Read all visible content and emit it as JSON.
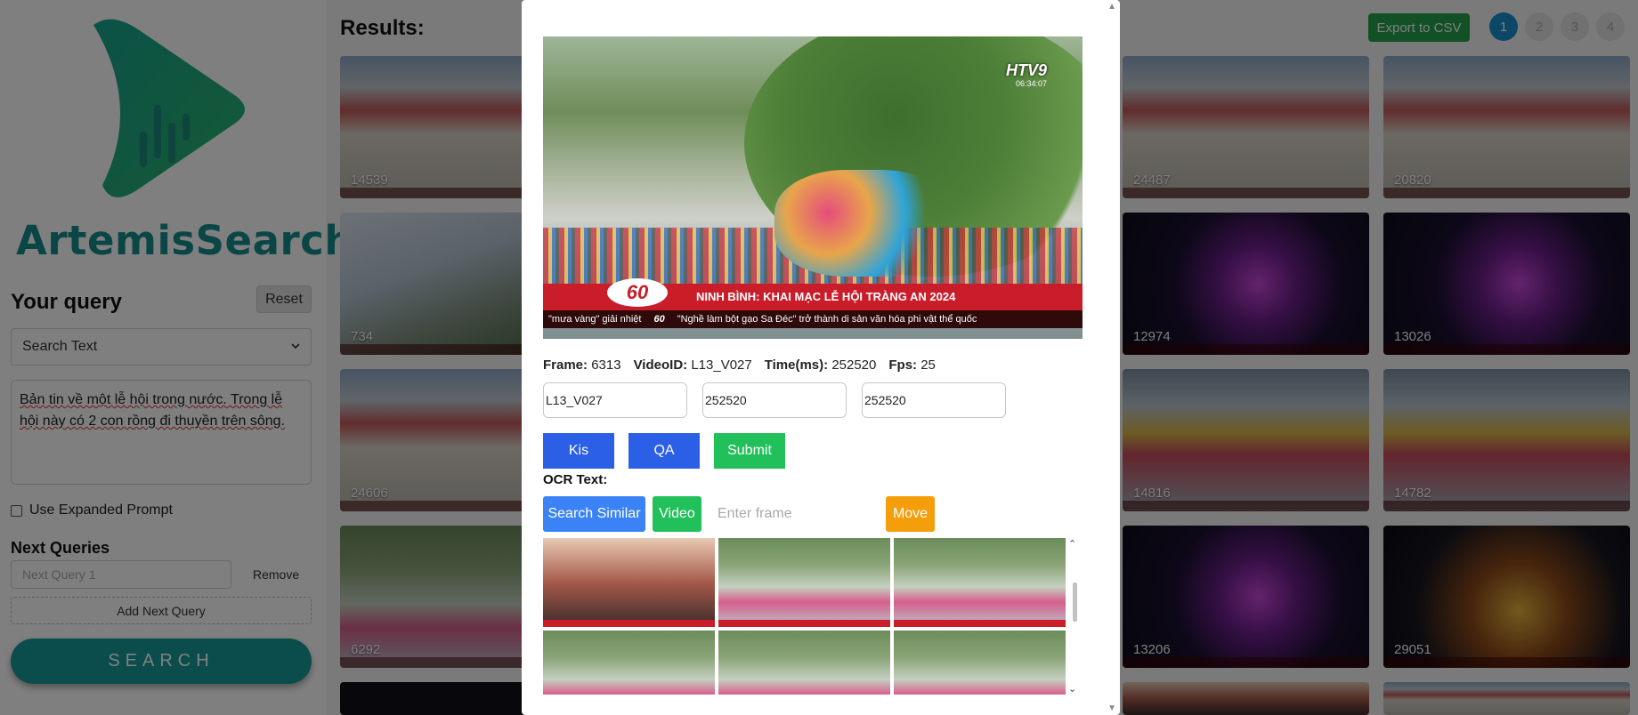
{
  "sidebar": {
    "brand": "ArtemisSearch",
    "query_title": "Your query",
    "reset_label": "Reset",
    "search_mode": "Search Text",
    "query_text_1": "Bản tin về một lễ hội trong nước. Trong lễ",
    "query_text_2": "hội này có 2 con rồng đi thuyền trên sông.",
    "expanded_prompt_label": "Use Expanded Prompt",
    "next_queries_title": "Next Queries",
    "next_query_placeholder": "Next Query 1",
    "remove_label": "Remove",
    "add_next_label": "Add Next Query",
    "search_label": "SEARCH"
  },
  "results": {
    "title": "Results:",
    "export_label": "Export to CSV",
    "pages": [
      "1",
      "2",
      "3",
      "4"
    ],
    "active_page": "1",
    "thumbnails": [
      {
        "label": "14539",
        "scene": "festival"
      },
      {
        "label": "734",
        "scene": "city"
      },
      {
        "label": "24606",
        "scene": "festival"
      },
      {
        "label": "6292",
        "scene": "river"
      },
      {
        "label": "24487",
        "scene": "festival"
      },
      {
        "label": "12974",
        "scene": "night"
      },
      {
        "label": "14816",
        "scene": "boats"
      },
      {
        "label": "13206",
        "scene": "night"
      },
      {
        "label": "20820",
        "scene": "festival"
      },
      {
        "label": "13026",
        "scene": "night"
      },
      {
        "label": "14782",
        "scene": "boats"
      },
      {
        "label": "29051",
        "scene": "gold"
      }
    ]
  },
  "modal": {
    "frame_label": "Frame:",
    "frame_value": "6313",
    "video_label": "VideoID:",
    "video_value": "L13_V027",
    "time_label": "Time(ms):",
    "time_value": "252520",
    "fps_label": "Fps:",
    "fps_value": "25",
    "field_video": "L13_V027",
    "field_time_1": "252520",
    "field_time_2": "252520",
    "kis_label": "Kis",
    "qa_label": "QA",
    "submit_label": "Submit",
    "ocr_label": "OCR Text:",
    "search_similar_label": "Search Similar",
    "video_button_label": "Video",
    "enter_frame_placeholder": "Enter frame",
    "move_label": "Move",
    "preview": {
      "channel": "HTV9",
      "clock": "06:34:07",
      "logo": "60",
      "headline": "NINH BÌNH: KHAI MẠC LỄ HỘI TRÀNG AN 2024",
      "ticker_left": "\"mưa vàng\" giải nhiệt",
      "ticker_right": "\"Nghề làm bột gạo Sa Đéc\" trở thành di sản văn hóa phi vật thể quốc"
    },
    "gallery": [
      "studio",
      "river",
      "river",
      "river",
      "river",
      "river"
    ]
  },
  "colors": {
    "brand_teal": "#178c8c",
    "accent_blue": "#2b5fe6",
    "accent_green": "#22c05a",
    "accent_orange": "#f59e0b",
    "page_active": "#1a8fd0"
  }
}
